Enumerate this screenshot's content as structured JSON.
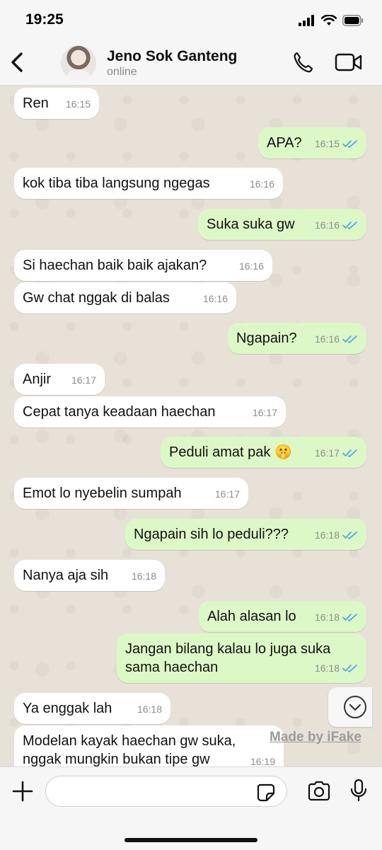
{
  "status_bar": {
    "time": "19:25"
  },
  "header": {
    "contact_name": "Jeno Sok Ganteng",
    "status": "online"
  },
  "colors": {
    "incoming_bubble": "#ffffff",
    "outgoing_bubble": "#dcf8c6",
    "tick_read": "#4fa3e8",
    "chat_background": "#e7e1d8"
  },
  "messages": [
    {
      "direction": "in",
      "text": "Ren",
      "time": "16:15"
    },
    {
      "direction": "out",
      "text": "APA?",
      "time": "16:15",
      "status": "read"
    },
    {
      "direction": "in",
      "text": "kok tiba tiba langsung ngegas",
      "time": "16:16"
    },
    {
      "direction": "out",
      "text": "Suka suka gw",
      "time": "16:16",
      "status": "read"
    },
    {
      "direction": "in",
      "text": "Si haechan baik baik ajakan?",
      "time": "16:16"
    },
    {
      "direction": "in",
      "text": "Gw chat nggak di balas",
      "time": "16:16"
    },
    {
      "direction": "out",
      "text": "Ngapain?",
      "time": "16:16",
      "status": "read"
    },
    {
      "direction": "in",
      "text": "Anjir",
      "time": "16:17"
    },
    {
      "direction": "in",
      "text": "Cepat tanya keadaan haechan",
      "time": "16:17"
    },
    {
      "direction": "out",
      "text": "Peduli amat pak 🤫",
      "time": "16:17",
      "status": "read"
    },
    {
      "direction": "in",
      "text": "Emot lo nyebelin sumpah",
      "time": "16:17"
    },
    {
      "direction": "out",
      "text": "Ngapain sih lo peduli???",
      "time": "16:18",
      "status": "read"
    },
    {
      "direction": "in",
      "text": "Nanya aja sih",
      "time": "16:18"
    },
    {
      "direction": "out",
      "text": "Alah alasan lo",
      "time": "16:18",
      "status": "read"
    },
    {
      "direction": "out",
      "text": "Jangan bilang kalau lo juga suka\nsama haechan",
      "time": "16:18",
      "status": "read"
    },
    {
      "direction": "in",
      "text": "Ya enggak lah",
      "time": "16:18"
    },
    {
      "direction": "in",
      "text": "Modelan kayak haechan gw suka,\nnggak mungkin bukan tipe gw",
      "time": "16:19"
    }
  ],
  "watermark": "Made by iFake",
  "input": {
    "placeholder": "",
    "value": ""
  },
  "icons": {
    "back": "chevron-left-icon",
    "call": "phone-icon",
    "video": "video-camera-icon",
    "attach": "plus-icon",
    "sticker": "sticker-icon",
    "camera": "camera-icon",
    "mic": "microphone-icon",
    "scroll": "chevron-down-circle-icon"
  }
}
